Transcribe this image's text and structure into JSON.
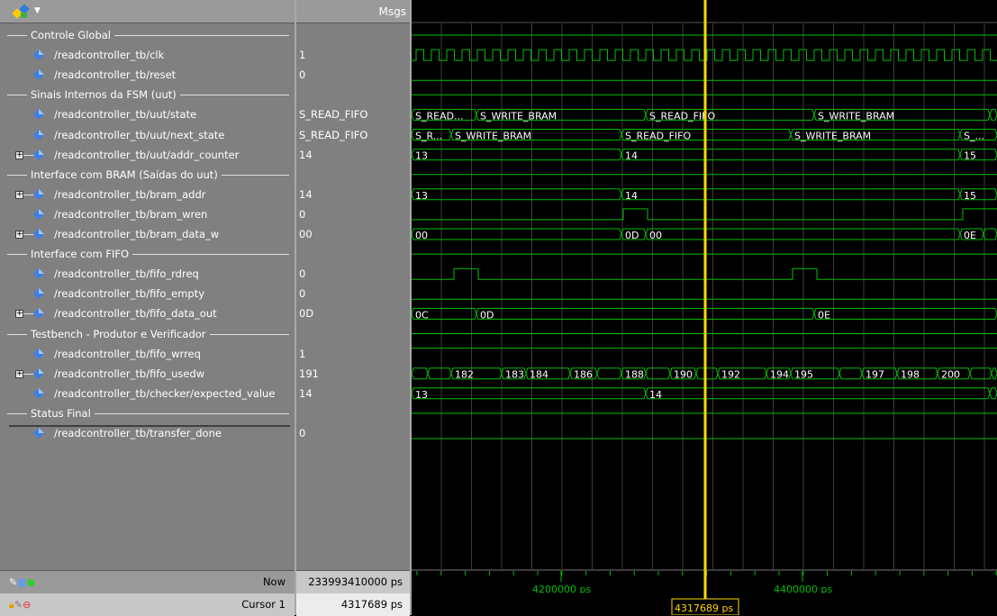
{
  "header": {
    "messages_label": "Msgs"
  },
  "rows": [
    {
      "type": "group",
      "label": "Controle Global"
    },
    {
      "type": "signal",
      "name": "/readcontroller_tb/clk",
      "value": "1",
      "expand": false
    },
    {
      "type": "signal",
      "name": "/readcontroller_tb/reset",
      "value": "0",
      "expand": false
    },
    {
      "type": "group",
      "label": "Sinais Internos da FSM (uut)"
    },
    {
      "type": "signal",
      "name": "/readcontroller_tb/uut/state",
      "value": "S_READ_FIFO",
      "expand": false
    },
    {
      "type": "signal",
      "name": "/readcontroller_tb/uut/next_state",
      "value": "S_READ_FIFO",
      "expand": false
    },
    {
      "type": "signal",
      "name": "/readcontroller_tb/uut/addr_counter",
      "value": "14",
      "expand": true
    },
    {
      "type": "group",
      "label": "Interface com BRAM (Saídas do uut)"
    },
    {
      "type": "signal",
      "name": "/readcontroller_tb/bram_addr",
      "value": "14",
      "expand": true
    },
    {
      "type": "signal",
      "name": "/readcontroller_tb/bram_wren",
      "value": "0",
      "expand": false
    },
    {
      "type": "signal",
      "name": "/readcontroller_tb/bram_data_w",
      "value": "00",
      "expand": true
    },
    {
      "type": "group",
      "label": "Interface com FIFO"
    },
    {
      "type": "signal",
      "name": "/readcontroller_tb/fifo_rdreq",
      "value": "0",
      "expand": false
    },
    {
      "type": "signal",
      "name": "/readcontroller_tb/fifo_empty",
      "value": "0",
      "expand": false
    },
    {
      "type": "signal",
      "name": "/readcontroller_tb/fifo_data_out",
      "value": "0D",
      "expand": true
    },
    {
      "type": "group",
      "label": "Testbench - Produtor e Verificador"
    },
    {
      "type": "signal",
      "name": "/readcontroller_tb/fifo_wrreq",
      "value": "1",
      "expand": false
    },
    {
      "type": "signal",
      "name": "/readcontroller_tb/fifo_usedw",
      "value": "191",
      "expand": true
    },
    {
      "type": "signal",
      "name": "/readcontroller_tb/checker/expected_value",
      "value": "14",
      "expand": false
    },
    {
      "type": "group",
      "label": "Status Final"
    },
    {
      "type": "signal",
      "name": "/readcontroller_tb/transfer_done",
      "value": "0",
      "expand": false
    }
  ],
  "footer": {
    "now_label": "Now",
    "now_value": "233993410000 ps",
    "cursor_label": "Cursor 1",
    "cursor_value": "4317689 ps"
  },
  "timeline": {
    "ticks": [
      "4200000 ps",
      "4400000 ps"
    ],
    "cursor_time": "4317689 ps"
  },
  "waves": {
    "state_labels": [
      "S_READ...",
      "S_WRITE_BRAM",
      "S_READ_FIFO",
      "S_WRITE_BRAM"
    ],
    "next_state_labels": [
      "S_R...",
      "S_WRITE_BRAM",
      "S_READ_FIFO",
      "S_WRITE_BRAM",
      "S_..."
    ],
    "addr_counter_labels": [
      "13",
      "14",
      "15"
    ],
    "bram_addr_labels": [
      "13",
      "14",
      "15"
    ],
    "bram_data_w_labels": [
      "00",
      "0D",
      "00",
      "0E"
    ],
    "fifo_data_out_labels": [
      "0C",
      "0D",
      "0E"
    ],
    "fifo_usedw_labels": [
      "182",
      "183",
      "184",
      "186",
      "188",
      "190",
      "192",
      "194",
      "195",
      "197",
      "198",
      "200"
    ],
    "expected_value_labels": [
      "13",
      "14"
    ]
  },
  "colors": {
    "wave": "#00c000",
    "cursor": "#ffd700",
    "grid": "#3c3c3c",
    "label": "#ffffff"
  }
}
